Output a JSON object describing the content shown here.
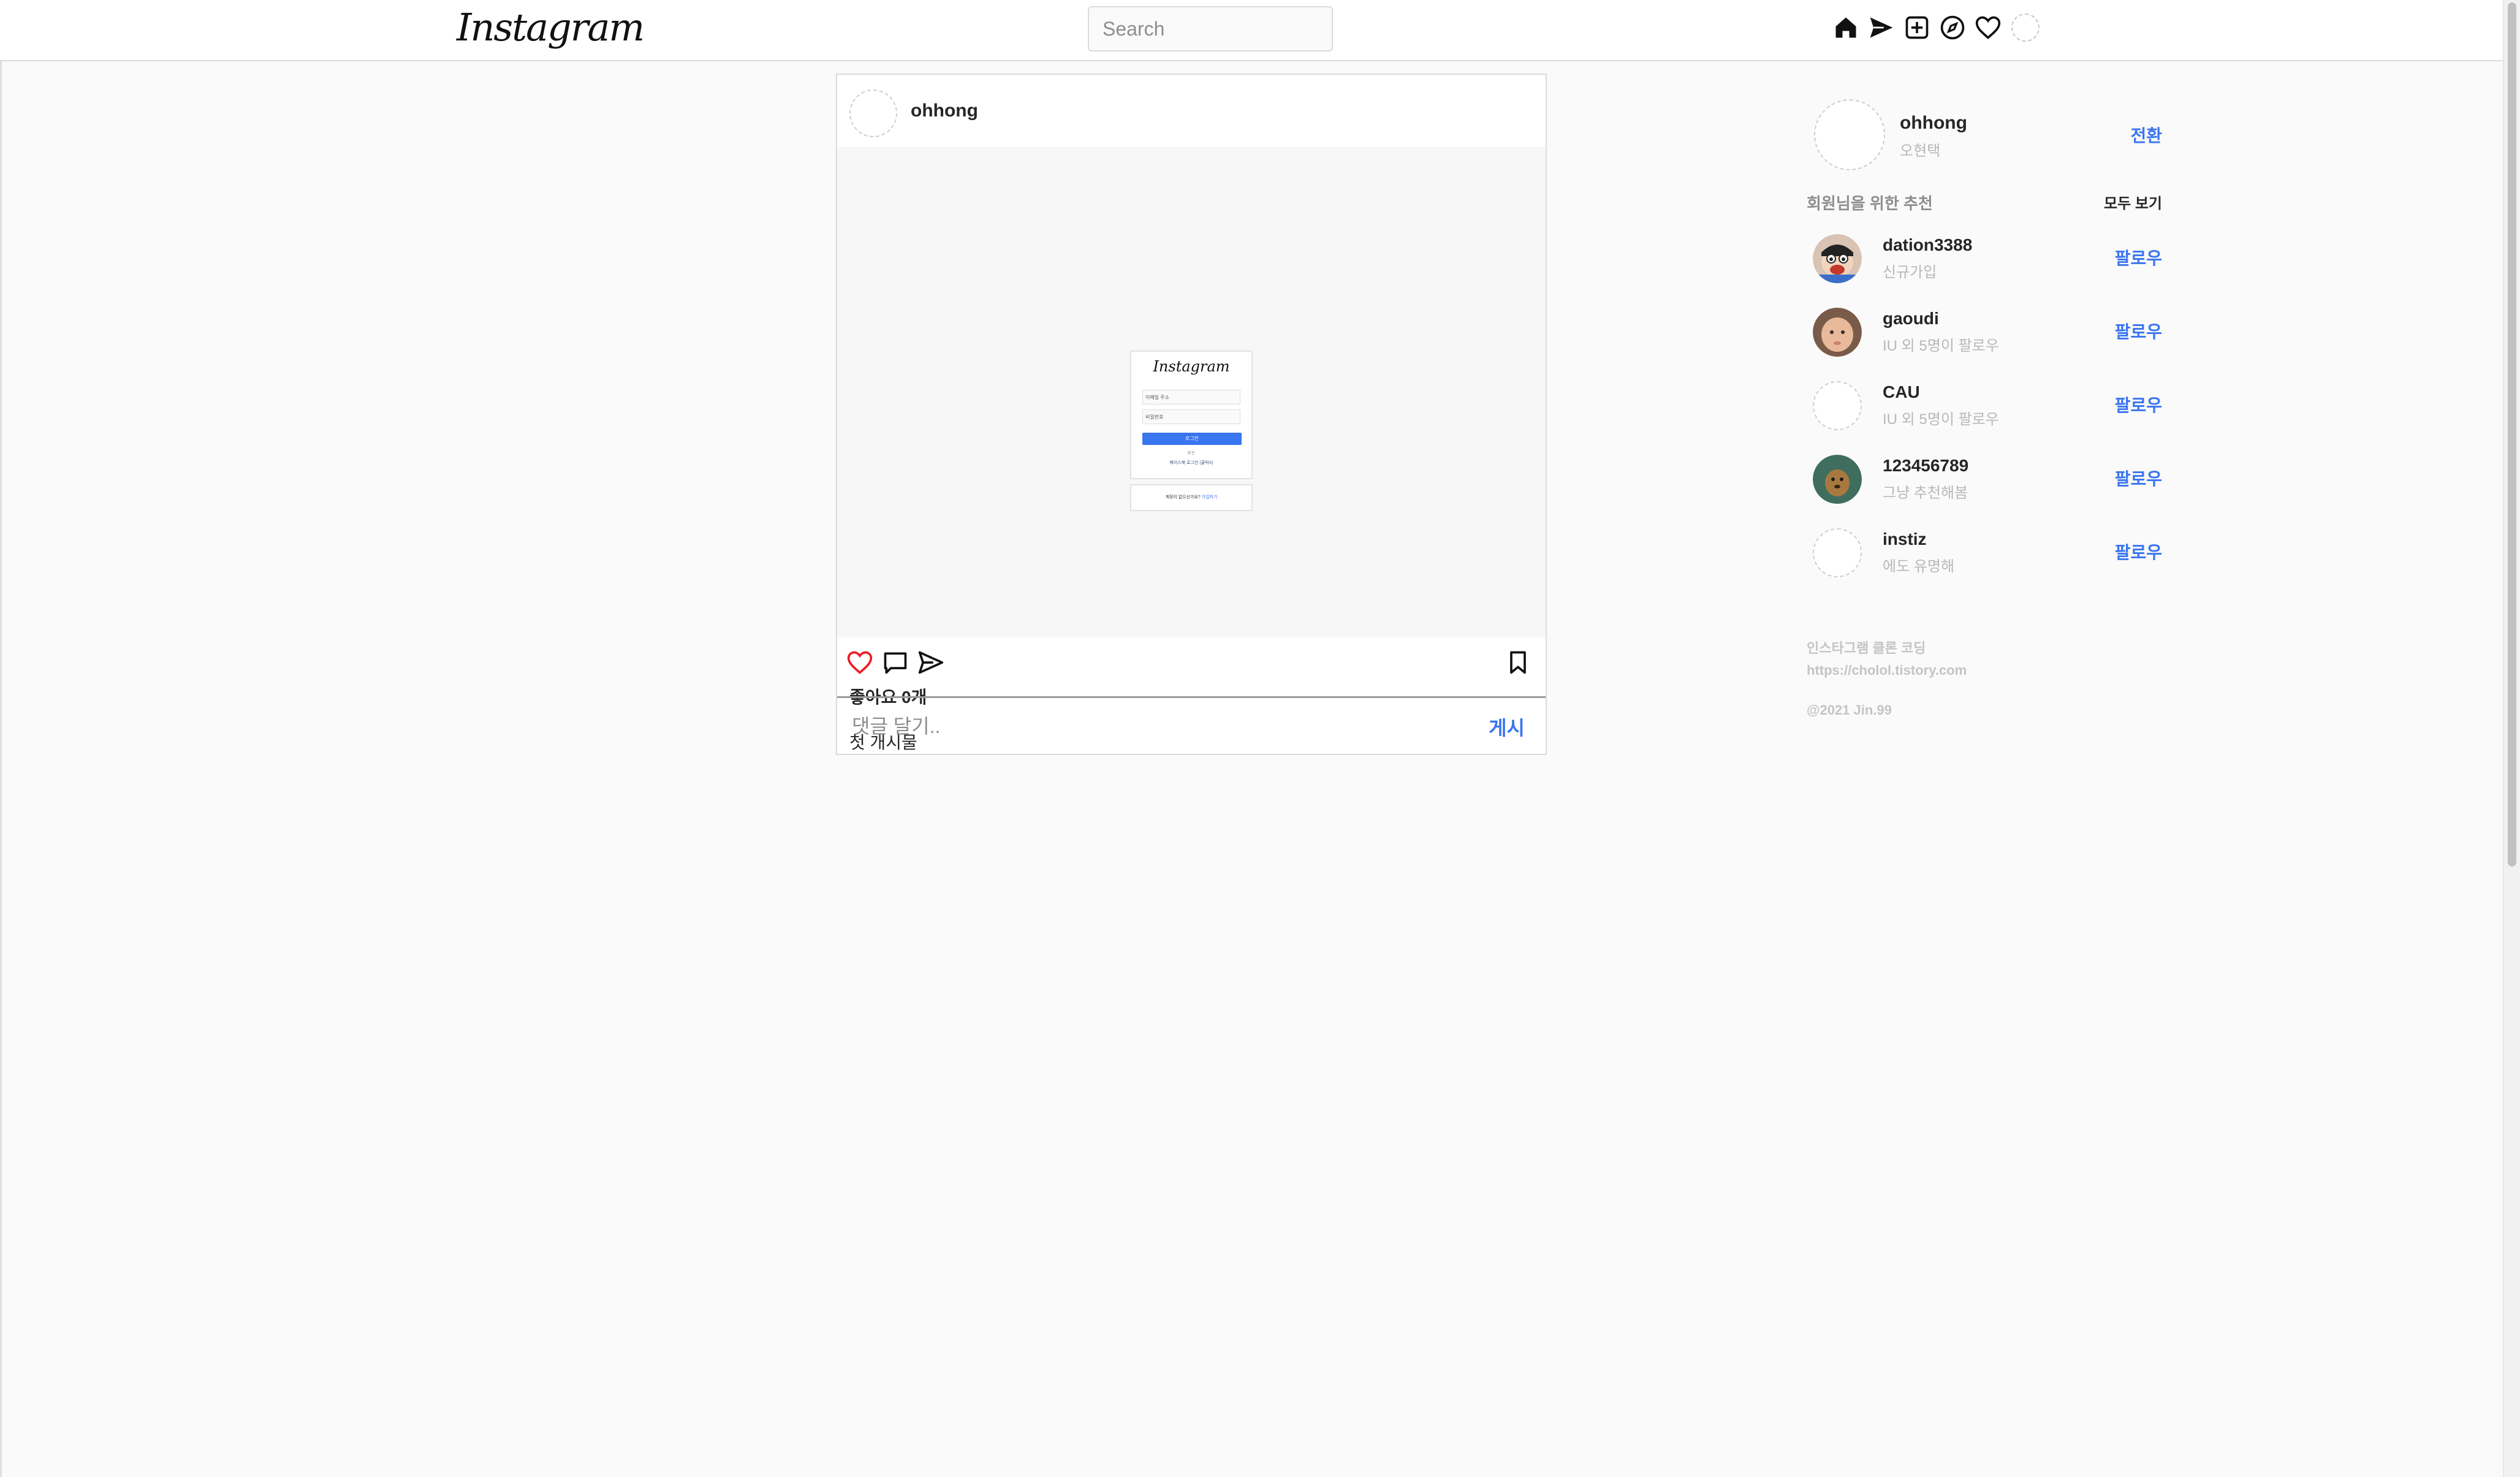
{
  "header": {
    "logo": "Instagram",
    "search_placeholder": "Search"
  },
  "post": {
    "username": "ohhong",
    "likes": "좋아요 0개",
    "caption": "첫 개시물",
    "comment_placeholder": "댓글 달기..",
    "post_button": "게시",
    "image_preview": {
      "logo": "Instagram",
      "email_placeholder": "이메일 주소",
      "password_placeholder": "비밀번호",
      "login_button": "로그인",
      "or": "또는",
      "facebook_login": "페이스북 로그인 (클릭X)",
      "signup_text": "계정이 없으신가요?",
      "signup_link": "가입하기"
    }
  },
  "sidebar": {
    "me": {
      "username": "ohhong",
      "name": "오현택",
      "switch_label": "전환"
    },
    "suggestions_title": "회원님을 위한 추천",
    "see_all": "모두 보기",
    "suggestions": [
      {
        "username": "dation3388",
        "subtitle": "신규가입",
        "follow": "팔로우",
        "avatar": "cartoon-avatar"
      },
      {
        "username": "gaoudi",
        "subtitle": "IU 외 5명이 팔로우",
        "follow": "팔로우",
        "avatar": "baby-photo-avatar"
      },
      {
        "username": "CAU",
        "subtitle": "IU 외 5명이 팔로우",
        "follow": "팔로우",
        "avatar": "broken-image"
      },
      {
        "username": "123456789",
        "subtitle": "그냥 추천해봄",
        "follow": "팔로우",
        "avatar": "animal-photo-avatar"
      },
      {
        "username": "instiz",
        "subtitle": "에도 유명해",
        "follow": "팔로우",
        "avatar": "broken-image"
      }
    ],
    "footer_line1": "인스타그램 클론 코딩",
    "footer_line2": "https://cholol.tistory.com",
    "copyright": "@2021 Jin.99"
  },
  "colors": {
    "accent": "#3a75f0",
    "like": "#ed1c24",
    "border": "#dbdbdb"
  }
}
